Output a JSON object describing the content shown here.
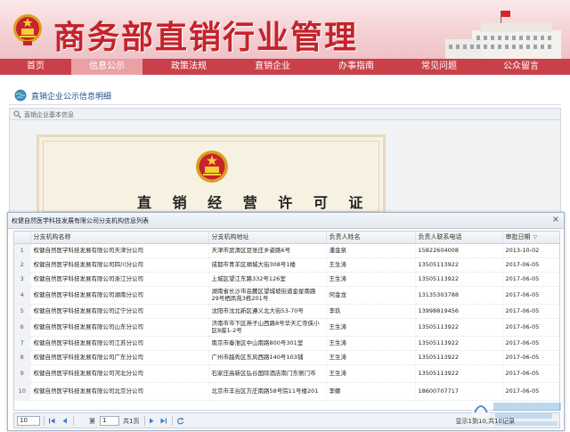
{
  "header": {
    "title": "商务部直销行业管理"
  },
  "nav": {
    "items": [
      {
        "label": "首页",
        "active": false
      },
      {
        "label": "信息公示",
        "active": true
      },
      {
        "label": "政策法规",
        "active": false
      },
      {
        "label": "直销企业",
        "active": false
      },
      {
        "label": "办事指南",
        "active": false
      },
      {
        "label": "常见问题",
        "active": false
      },
      {
        "label": "公众留言",
        "active": false
      }
    ]
  },
  "section": {
    "title": "直销企业公示信息明细",
    "panel_title": "直销企业基本信息"
  },
  "certificate": {
    "title": "直 销 经 营 许 可 证"
  },
  "dialog": {
    "title": "权健自然医学科技发展有限公司分支机构信息列表",
    "close_symbol": "×",
    "columns": [
      "分支机构名称",
      "分支机构地址",
      "负责人姓名",
      "负责人联系电话",
      "审批日期"
    ],
    "sort_symbol": "▽",
    "rows": [
      {
        "no": "1",
        "name": "权健自然医学科技发展有限公司天津分公司",
        "address": "天津市武清区豆张庄乡姿路6号",
        "person": "潘金泉",
        "phone": "15822604008",
        "date": "2013-10-02"
      },
      {
        "no": "2",
        "name": "权健自然医学科技发展有限公司四川分公司",
        "address": "成都市青羊区顺城大街308号1楼",
        "person": "王生涛",
        "phone": "13505113922",
        "date": "2017-06-05"
      },
      {
        "no": "3",
        "name": "权健自然医学科技发展有限公司浙江分公司",
        "address": "上城区望江东路332号126室",
        "person": "王生涛",
        "phone": "13505113922",
        "date": "2017-06-05"
      },
      {
        "no": "4",
        "name": "权健自然医学科技发展有限公司湖南分公司",
        "address": "湖南省长沙市岳麓区望城坡街道金星南路29号栖凤苑3栋201号",
        "person": "何金龙",
        "phone": "13135303788",
        "date": "2017-06-05"
      },
      {
        "no": "5",
        "name": "权健自然医学科技发展有限公司辽宁分公司",
        "address": "沈阳市沈北新区遵义北大街53-70号",
        "person": "李玖",
        "phone": "13998819456",
        "date": "2017-06-05"
      },
      {
        "no": "6",
        "name": "权健自然医学科技发展有限公司山东分公司",
        "address": "济南市市下区燕子山西路8号华天汇帝侠小区8座1-2号",
        "person": "王生涛",
        "phone": "13505113922",
        "date": "2017-06-05"
      },
      {
        "no": "7",
        "name": "权健自然医学科技发展有限公司江苏分公司",
        "address": "南京市秦淮区中山南路800号301室",
        "person": "王生涛",
        "phone": "13505113922",
        "date": "2017-06-05"
      },
      {
        "no": "8",
        "name": "权健自然医学科技发展有限公司广东分公司",
        "address": "广州市越秀区东风西路140号103铺",
        "person": "王生涛",
        "phone": "13505113922",
        "date": "2017-06-05"
      },
      {
        "no": "9",
        "name": "权健自然医学科技发展有限公司河北分公司",
        "address": "石家庄高新区弘谷国际酒店南门东侧门市",
        "person": "王生涛",
        "phone": "13505113922",
        "date": "2017-06-05"
      },
      {
        "no": "10",
        "name": "权健自然医学科技发展有限公司北京分公司",
        "address": "北京市丰台区方庄南路58号院11号楼201",
        "person": "李娜",
        "phone": "18600707717",
        "date": "2017-06-05"
      }
    ],
    "pager": {
      "page_size": "10",
      "page_label": "第",
      "page_value": "1",
      "total_pages": "共1页",
      "summary": "显示1到10,共10记录"
    }
  }
}
